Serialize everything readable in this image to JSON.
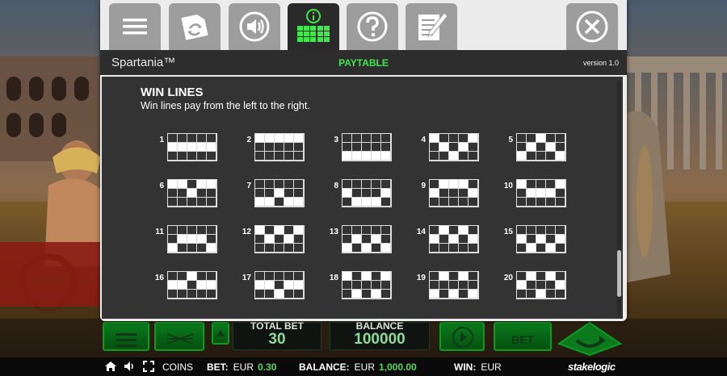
{
  "modal": {
    "tabs": [
      {
        "name": "menu-icon"
      },
      {
        "name": "autoplay-settings-icon"
      },
      {
        "name": "sound-icon"
      },
      {
        "name": "paytable-icon",
        "active": true
      },
      {
        "name": "help-icon"
      },
      {
        "name": "history-icon"
      },
      {
        "name": "close-icon"
      }
    ],
    "game_title": "Spartania™",
    "page_title": "PAYTABLE",
    "version": "version 1.0",
    "section_title": "WIN LINES",
    "section_desc": "Win lines pay from the left to the right.",
    "win_lines": [
      {
        "number": "1",
        "rows": [
          1,
          1,
          1,
          1,
          1
        ]
      },
      {
        "number": "2",
        "rows": [
          0,
          0,
          0,
          0,
          0
        ]
      },
      {
        "number": "3",
        "rows": [
          2,
          2,
          2,
          2,
          2
        ]
      },
      {
        "number": "4",
        "rows": [
          0,
          1,
          2,
          1,
          0
        ]
      },
      {
        "number": "5",
        "rows": [
          2,
          1,
          0,
          1,
          2
        ]
      },
      {
        "number": "6",
        "rows": [
          0,
          0,
          1,
          0,
          0
        ]
      },
      {
        "number": "7",
        "rows": [
          2,
          2,
          1,
          2,
          2
        ]
      },
      {
        "number": "8",
        "rows": [
          1,
          2,
          2,
          2,
          1
        ]
      },
      {
        "number": "9",
        "rows": [
          1,
          0,
          0,
          0,
          1
        ]
      },
      {
        "number": "10",
        "rows": [
          0,
          1,
          1,
          1,
          0
        ]
      },
      {
        "number": "11",
        "rows": [
          2,
          1,
          1,
          1,
          2
        ]
      },
      {
        "number": "12",
        "rows": [
          0,
          1,
          0,
          1,
          0
        ]
      },
      {
        "number": "13",
        "rows": [
          2,
          1,
          2,
          1,
          2
        ]
      },
      {
        "number": "14",
        "rows": [
          1,
          0,
          1,
          0,
          1
        ]
      },
      {
        "number": "15",
        "rows": [
          1,
          2,
          1,
          2,
          1
        ]
      },
      {
        "number": "16",
        "rows": [
          1,
          1,
          0,
          1,
          1
        ]
      },
      {
        "number": "17",
        "rows": [
          1,
          1,
          2,
          1,
          1
        ]
      },
      {
        "number": "18",
        "rows": [
          0,
          2,
          0,
          2,
          0
        ]
      },
      {
        "number": "19",
        "rows": [
          2,
          0,
          2,
          0,
          2
        ]
      },
      {
        "number": "20",
        "rows": [
          1,
          0,
          2,
          0,
          1
        ]
      }
    ]
  },
  "game_controls": {
    "total_bet_label": "TOTAL BET",
    "total_bet_value": "30",
    "balance_label": "BALANCE",
    "balance_value": "100000",
    "max_bet_label": "BET"
  },
  "status_bar": {
    "coins_label": "COINS",
    "bet_label": "BET:",
    "bet_currency": "EUR",
    "bet_value": "0.30",
    "balance_label": "BALANCE:",
    "balance_currency": "EUR",
    "balance_value": "1,000.00",
    "win_label": "WIN:",
    "win_currency": "EUR",
    "brand": "stakelogic"
  },
  "colors": {
    "accent_green": "#3ee74a",
    "value_green": "#52d85e",
    "modal_panel": "#333333",
    "tab_gray": "#9d9d9d"
  }
}
